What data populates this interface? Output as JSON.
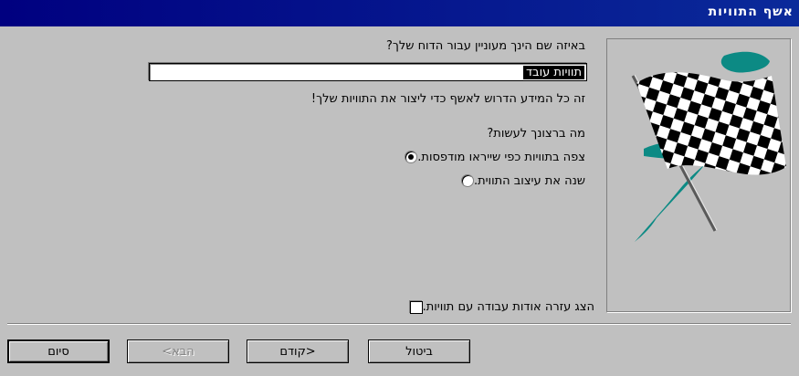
{
  "window": {
    "title": "אשף התוויות"
  },
  "name_question": "באיזה שם הינך מעוניין עבור הדוח שלך?",
  "report_name_value": "תוויות עובד",
  "info_text": "זה כל המידע הדרוש לאשף כדי ליצור את התוויות שלך!",
  "action_question": "מה ברצונך לעשות?",
  "options": [
    {
      "label": "צפה בתוויות כפי שייראו מודפסות.",
      "selected": true
    },
    {
      "label": "שנה את עיצוב התווית.",
      "selected": false
    }
  ],
  "help_checkbox": {
    "label": "הצג עזרה אודות עבודה עם תוויות.",
    "checked": false
  },
  "buttons": {
    "cancel": "ביטול",
    "back": "<קודם",
    "next": "הבא>",
    "finish": "סיום"
  },
  "image": {
    "icon": "checkered-flag-icon",
    "accent_color": "#0c8a84"
  }
}
